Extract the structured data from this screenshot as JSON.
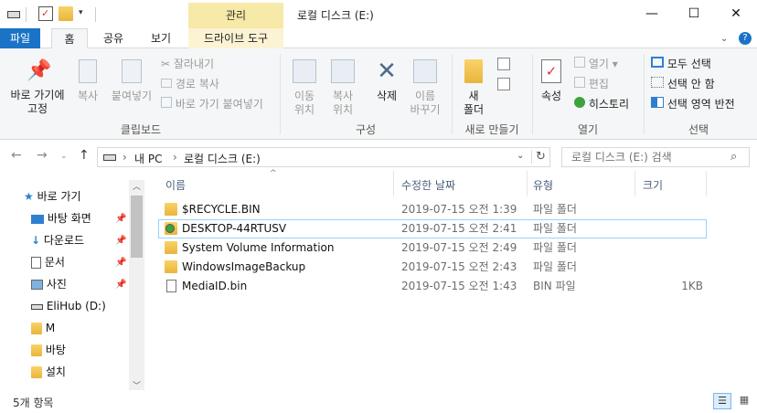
{
  "title_bar": {
    "context_tab": "관리",
    "window_title": "로컬 디스크 (E:)",
    "minimize_glyph": "—",
    "maximize_glyph": "☐",
    "close_glyph": "✕"
  },
  "tabs": [
    {
      "label": "파일"
    },
    {
      "label": "홈"
    },
    {
      "label": "공유"
    },
    {
      "label": "보기"
    },
    {
      "label": "드라이브 도구"
    }
  ],
  "ribbon": {
    "clipboard": {
      "pin_label": "바로 가기에\n고정",
      "copy_label": "복사",
      "paste_label": "붙여넣기",
      "cut_label": "잘라내기",
      "copy_path_label": "경로 복사",
      "paste_shortcut_label": "바로 가기 붙여넣기",
      "group_label": "클립보드"
    },
    "organize": {
      "move_label": "이동\n위치",
      "copy_to_label": "복사\n위치",
      "delete_label": "삭제",
      "rename_label": "이름\n바꾸기",
      "group_label": "구성"
    },
    "new": {
      "new_folder_label": "새\n폴더",
      "group_label": "새로 만들기"
    },
    "open": {
      "properties_label": "속성",
      "open_label": "열기",
      "edit_label": "편집",
      "history_label": "히스토리",
      "group_label": "열기"
    },
    "select": {
      "select_all_label": "모두 선택",
      "select_none_label": "선택 안 함",
      "invert_label": "선택 영역 반전",
      "group_label": "선택"
    }
  },
  "address": {
    "path": [
      "내 PC",
      "로컬 디스크 (E:)"
    ],
    "search_placeholder": "로컬 디스크 (E:) 검색"
  },
  "nav_pane": {
    "items": [
      {
        "label": "바로 가기",
        "icon": "star-icon",
        "pinned": false
      },
      {
        "label": "바탕 화면",
        "icon": "desktop-icon",
        "pinned": true
      },
      {
        "label": "다운로드",
        "icon": "download-icon",
        "pinned": true
      },
      {
        "label": "문서",
        "icon": "document-icon",
        "pinned": true
      },
      {
        "label": "사진",
        "icon": "pictures-icon",
        "pinned": true
      },
      {
        "label": "EliHub (D:)",
        "icon": "drive-icon",
        "pinned": false
      },
      {
        "label": "M",
        "icon": "folder-icon",
        "pinned": false
      },
      {
        "label": "바탕",
        "icon": "folder-icon",
        "pinned": false
      },
      {
        "label": "설치",
        "icon": "folder-icon",
        "pinned": false
      }
    ]
  },
  "file_list": {
    "columns": {
      "name": "이름",
      "date": "수정한 날짜",
      "type": "유형",
      "size": "크기"
    },
    "rows": [
      {
        "name": "$RECYCLE.BIN",
        "date": "2019-07-15 오전 1:39",
        "type": "파일 폴더",
        "size": "",
        "icon": "folder-icon"
      },
      {
        "name": "DESKTOP-44RTUSV",
        "date": "2019-07-15 오전 2:41",
        "type": "파일 폴더",
        "size": "",
        "icon": "backup-folder-icon"
      },
      {
        "name": "System Volume Information",
        "date": "2019-07-15 오전 2:49",
        "type": "파일 폴더",
        "size": "",
        "icon": "folder-icon"
      },
      {
        "name": "WindowsImageBackup",
        "date": "2019-07-15 오전 2:43",
        "type": "파일 폴더",
        "size": "",
        "icon": "folder-icon"
      },
      {
        "name": "MediaID.bin",
        "date": "2019-07-15 오전 1:43",
        "type": "BIN 파일",
        "size": "1KB",
        "icon": "file-icon"
      }
    ]
  },
  "status_bar": {
    "item_count": "5개 항목"
  },
  "colors": {
    "accent": "#1a73c6",
    "context_tab": "#f7e9a8",
    "folder": "#f2c24e"
  }
}
